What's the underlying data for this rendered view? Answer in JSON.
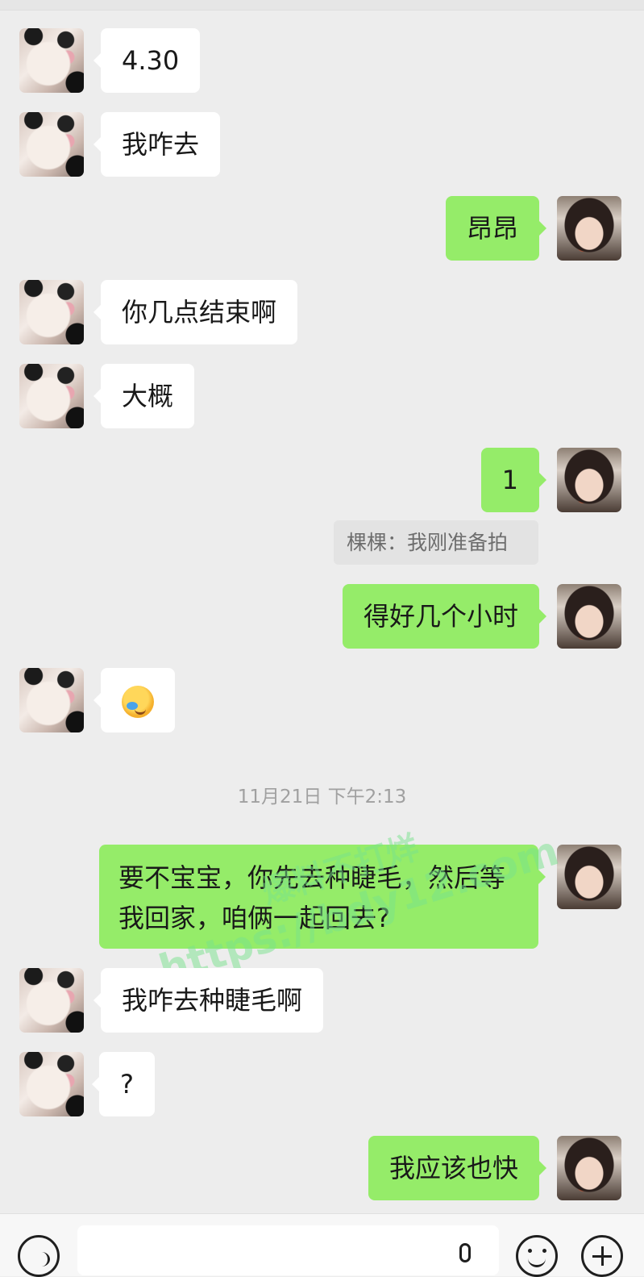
{
  "messages": [
    {
      "side": "left",
      "text": "4.30"
    },
    {
      "side": "left",
      "text": "我咋去"
    },
    {
      "side": "right",
      "text": "昂昂"
    },
    {
      "side": "left",
      "text": "你几点结束啊"
    },
    {
      "side": "left",
      "text": "大概"
    },
    {
      "side": "right",
      "text": "1"
    },
    {
      "quote": "棵棵：我刚准备拍"
    },
    {
      "side": "right",
      "text": "得好几个小时"
    },
    {
      "side": "left",
      "emoji": "facepalm-crying-emoji"
    },
    {
      "timestamp": "11月21日 下午2:13"
    },
    {
      "side": "right",
      "text": "要不宝宝，你先去种睫毛，然后等我回家，咱俩一起回去?"
    },
    {
      "side": "left",
      "text": "我咋去种睫毛啊"
    },
    {
      "side": "left",
      "text": "?"
    },
    {
      "side": "right",
      "text": "我应该也快"
    }
  ],
  "watermark": {
    "line1": "爆料不打烊",
    "line2": "https://bdy12.com"
  },
  "input_bar": {
    "voice_icon": "voice-icon",
    "mic_icon": "microphone-icon",
    "emoji_icon": "emoji-icon",
    "plus_icon": "plus-icon"
  },
  "colors": {
    "background": "#ededed",
    "sent_bubble": "#95ec69",
    "received_bubble": "#ffffff"
  }
}
